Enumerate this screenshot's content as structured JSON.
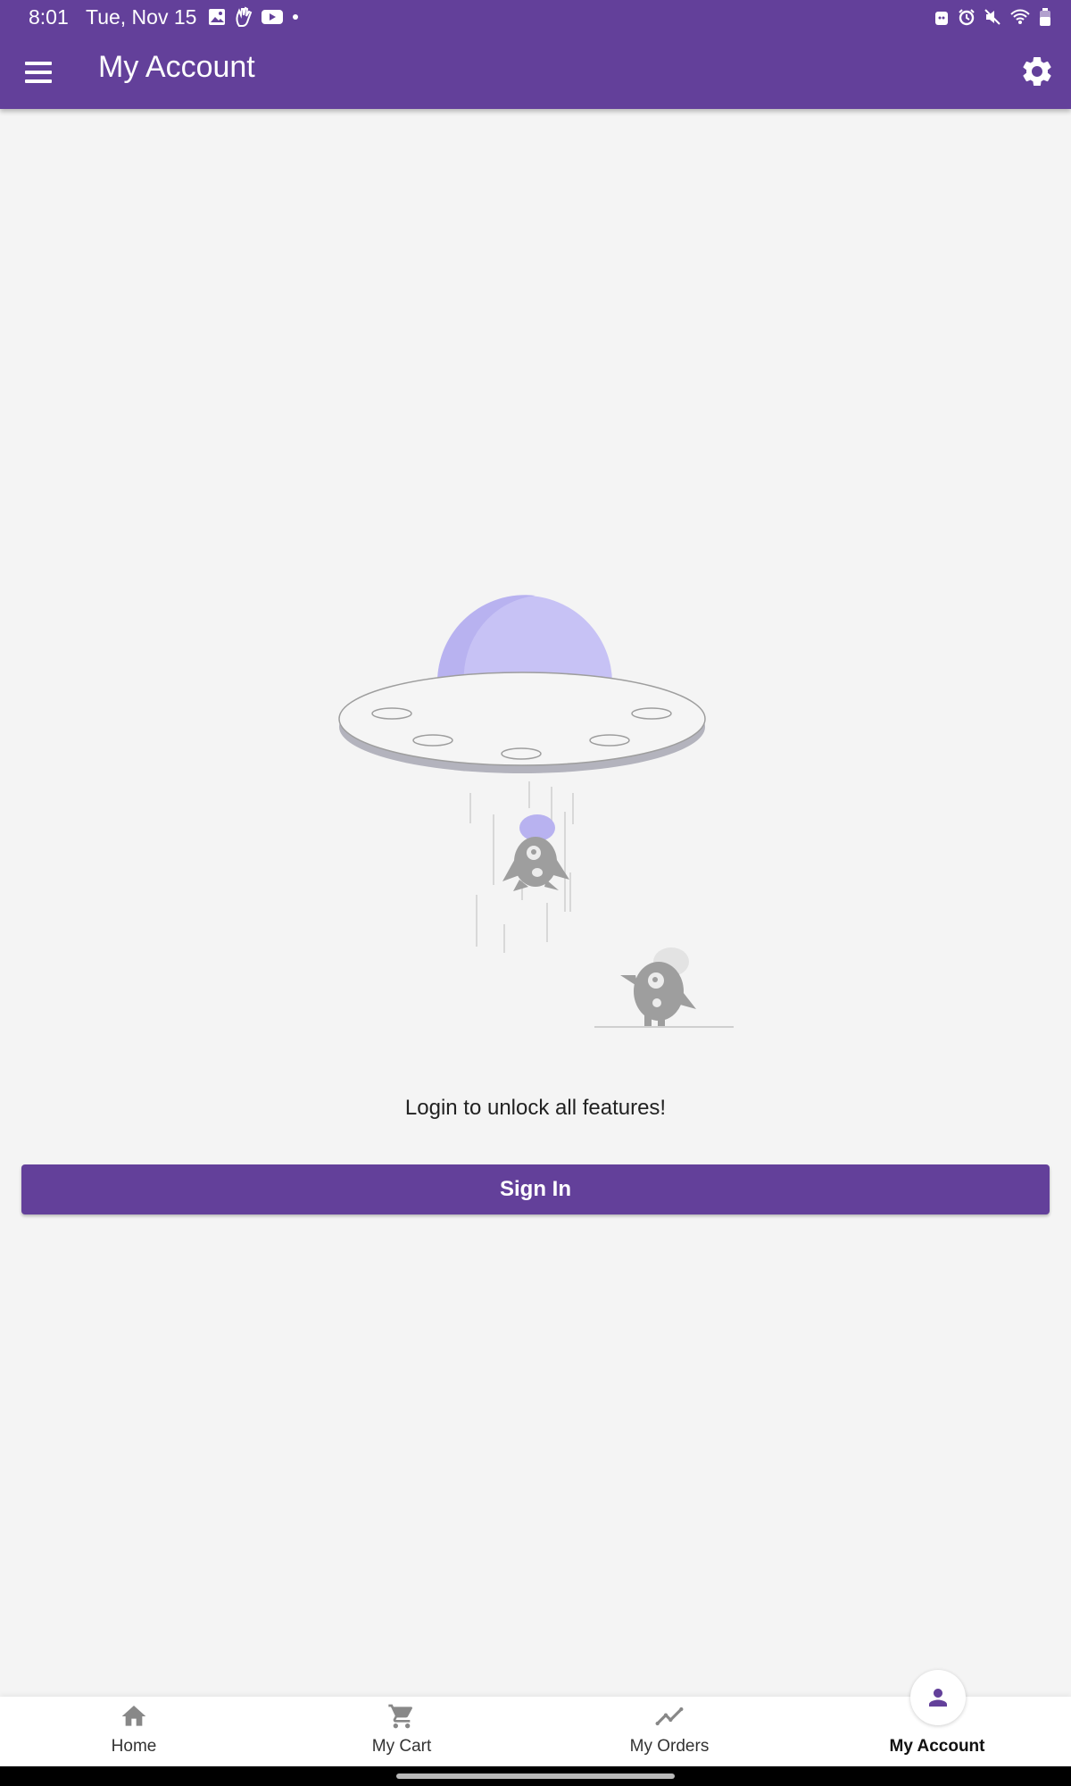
{
  "status_bar": {
    "time": "8:01",
    "date": "Tue, Nov 15"
  },
  "app_bar": {
    "title": "My Account",
    "menu_icon": "menu-icon",
    "settings_icon": "gear-icon",
    "color": "#63409a"
  },
  "empty_state": {
    "illustration": "ufo-illustration",
    "message": "Login to unlock all features!"
  },
  "sign_in": {
    "label": "Sign In"
  },
  "bottom_nav": {
    "items": [
      {
        "label": "Home",
        "icon": "home-icon",
        "active": false
      },
      {
        "label": "My Cart",
        "icon": "cart-icon",
        "active": false
      },
      {
        "label": "My Orders",
        "icon": "orders-trend-icon",
        "active": false
      },
      {
        "label": "My Account",
        "icon": "person-icon",
        "active": true
      }
    ]
  }
}
